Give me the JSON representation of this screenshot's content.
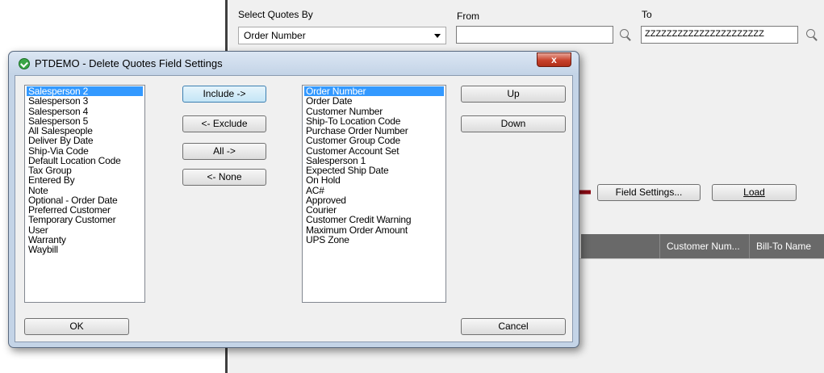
{
  "background": {
    "select_by_label": "Select Quotes By",
    "select_by_value": "Order Number",
    "from_label": "From",
    "from_value": "",
    "to_label": "To",
    "to_value": "ZZZZZZZZZZZZZZZZZZZZZZ",
    "field_settings_button": "Field Settings...",
    "load_button": "Load",
    "grid_columns": [
      "Customer Num...",
      "Bill-To Name"
    ]
  },
  "dialog": {
    "title": "PTDEMO - Delete Quotes Field Settings",
    "close_glyph": "x",
    "available_fields": [
      "Salesperson 2",
      "Salesperson 3",
      "Salesperson 4",
      "Salesperson 5",
      "All Salespeople",
      "Deliver By Date",
      "Ship-Via Code",
      "Default Location Code",
      "Tax Group",
      "Entered By",
      "Note",
      "Optional - Order Date",
      "Preferred Customer",
      "Temporary Customer",
      "User",
      "Warranty",
      "Waybill"
    ],
    "available_selected_index": 0,
    "included_fields": [
      "Order Number",
      "Order Date",
      "Customer Number",
      "Ship-To Location Code",
      "Purchase Order Number",
      "Customer Group Code",
      "Customer Account Set",
      "Salesperson 1",
      "Expected Ship Date",
      "On Hold",
      "AC#",
      "Approved",
      "Courier",
      "Customer Credit Warning",
      "Maximum Order Amount",
      "UPS Zone"
    ],
    "included_selected_index": 0,
    "buttons": {
      "include": "Include ->",
      "exclude": "<- Exclude",
      "all": "All ->",
      "none": "<- None",
      "up": "Up",
      "down": "Down",
      "ok": "OK",
      "cancel": "Cancel"
    }
  },
  "colors": {
    "selection": "#3399ff",
    "annotation_arrow": "#8b0a14",
    "grid_header": "#696969"
  }
}
